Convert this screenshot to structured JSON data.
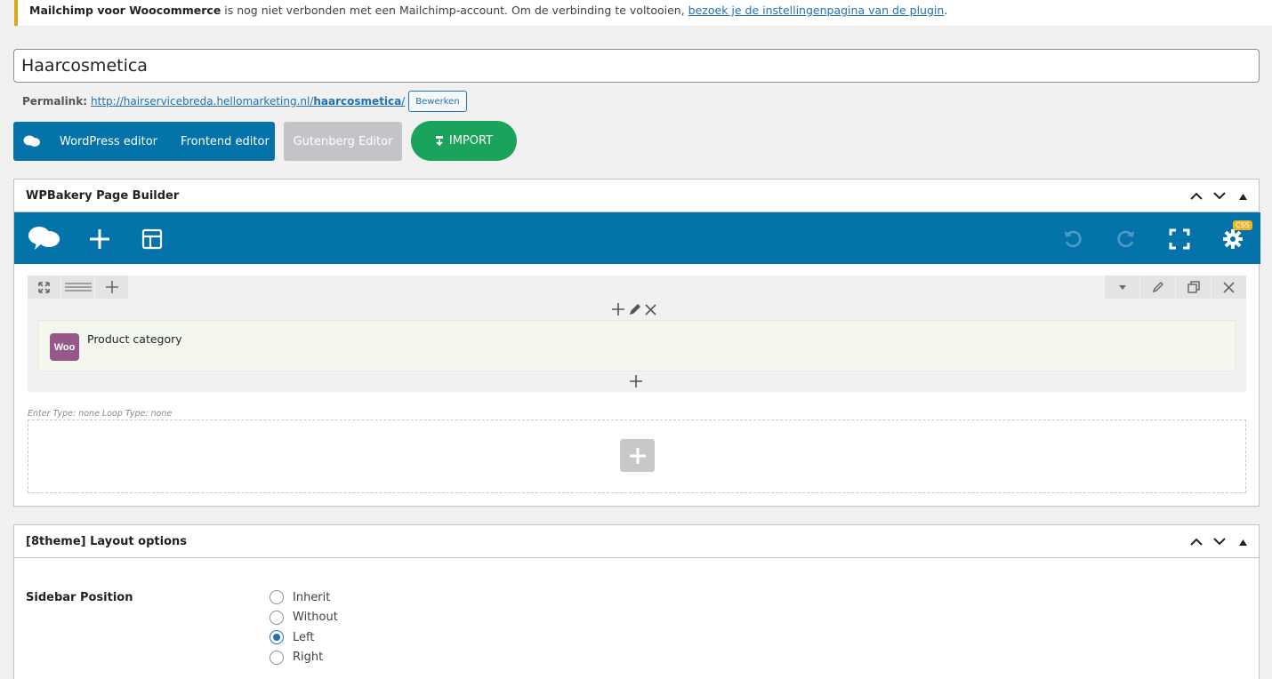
{
  "notice": {
    "plugin": "Mailchimp voor Woocommerce",
    "message": " is nog niet verbonden met een Mailchimp-account. Om de verbinding te voltooien, ",
    "link": "bezoek je de instellingenpagina van de plugin",
    "end": "."
  },
  "post": {
    "title": "Haarcosmetica",
    "permalink_label": "Permalink:",
    "permalink_base": "http://hairservicebreda.hellomarketing.nl/",
    "permalink_slug": "haarcosmetica",
    "permalink_end": "/",
    "edit_label": "Bewerken"
  },
  "editors": {
    "wordpress": "WordPress editor",
    "frontend": "Frontend editor",
    "gutenberg": "Gutenberg Editor",
    "import": "IMPORT"
  },
  "wpbakery": {
    "title": "WPBakery Page Builder",
    "css_badge": "CSS",
    "element_name": "Product category",
    "woo_label": "Woo",
    "enter_type": "Enter Type: none  Loop Type: none"
  },
  "layout_options": {
    "title": "[8theme] Layout options",
    "sidebar_label": "Sidebar Position",
    "options": [
      "Inherit",
      "Without",
      "Left",
      "Right"
    ],
    "selected": "Left"
  },
  "colors": {
    "vc_blue": "#0473aa",
    "import_green": "#1aa35b",
    "woo_purple": "#96588a",
    "notice_yellow": "#dba617"
  }
}
